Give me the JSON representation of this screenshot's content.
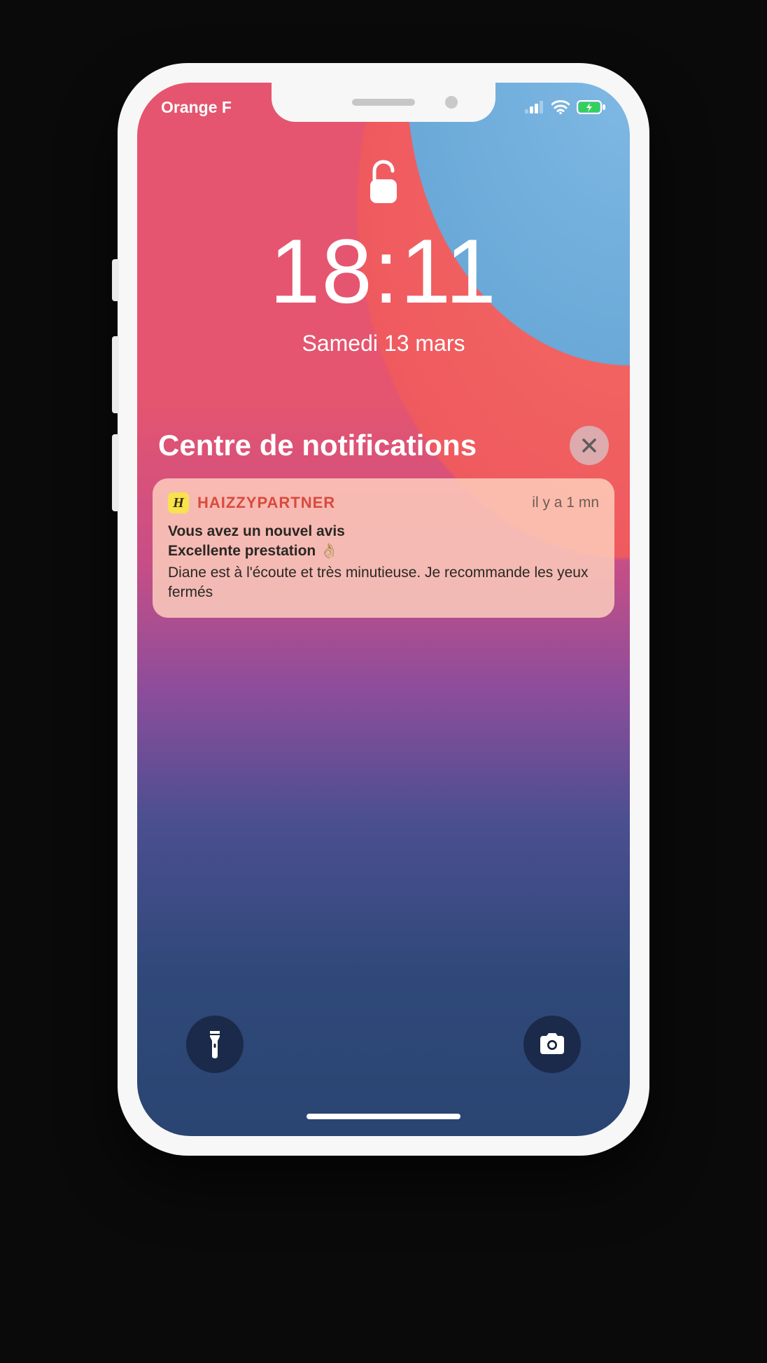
{
  "status": {
    "carrier": "Orange F"
  },
  "lockscreen": {
    "time": "18:11",
    "date": "Samedi 13 mars"
  },
  "notification_center": {
    "title": "Centre de notifications"
  },
  "notification": {
    "app_icon_letter": "H",
    "app_name": "HAIZZYPARTNER",
    "time": "il y a 1 mn",
    "title": "Vous avez un nouvel avis",
    "subtitle": "Excellente prestation 👌🏼",
    "body": "Diane est à l'écoute et très minutieuse. Je recommande les yeux fermés"
  }
}
